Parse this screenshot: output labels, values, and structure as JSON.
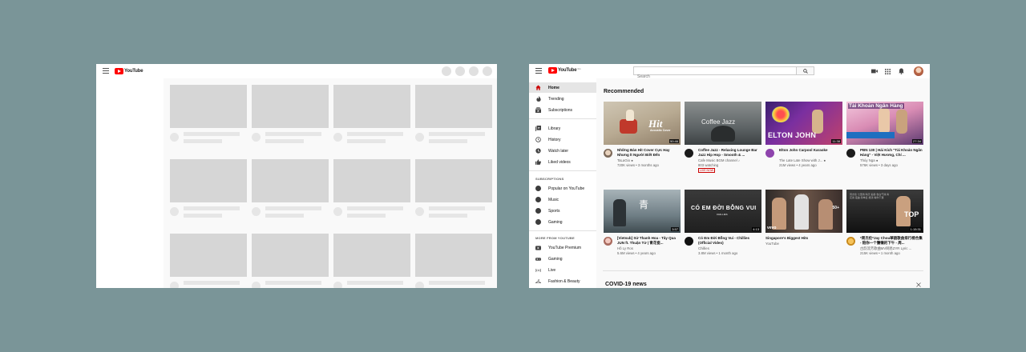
{
  "colors": {
    "background": "#7a9598",
    "brand_red": "#ff0000",
    "live_badge": "#cc0000"
  },
  "skeleton": {
    "logo_text": "YouTube"
  },
  "app": {
    "logo_text": "YouTube",
    "logo_region": "SG",
    "search": {
      "placeholder": "Search"
    },
    "header_icons": [
      "video-camera-icon",
      "apps-grid-icon",
      "bell-icon"
    ]
  },
  "sidebar": {
    "main": [
      {
        "label": "Home",
        "icon": "home-icon"
      },
      {
        "label": "Trending",
        "icon": "flame-icon"
      },
      {
        "label": "Subscriptions",
        "icon": "subscriptions-icon"
      }
    ],
    "library": [
      {
        "label": "Library",
        "icon": "library-icon"
      },
      {
        "label": "History",
        "icon": "history-icon"
      },
      {
        "label": "Watch later",
        "icon": "clock-icon"
      },
      {
        "label": "Liked videos",
        "icon": "thumb-up-icon"
      }
    ],
    "subscriptions_heading": "SUBSCRIPTIONS",
    "subscriptions": [
      {
        "label": "Popular on YouTube"
      },
      {
        "label": "Music"
      },
      {
        "label": "Sports"
      },
      {
        "label": "Gaming"
      }
    ],
    "more_heading": "MORE FROM YOUTUBE",
    "more": [
      {
        "label": "YouTube Premium",
        "icon": "youtube-icon"
      },
      {
        "label": "Gaming",
        "icon": "gamepad-icon"
      },
      {
        "label": "Live",
        "icon": "live-icon"
      },
      {
        "label": "Fashion & Beauty",
        "icon": "hanger-icon"
      }
    ]
  },
  "main": {
    "section_title": "Recommended",
    "videos": [
      {
        "title": "Những Bản Hit Cover Cực Hay Nhưng Ít Người Biết Đến",
        "channel": "TaLaGio",
        "verified": true,
        "stats": "720K views • 3 months ago",
        "duration": "50:46",
        "overlay": "Hit",
        "overlay2": "Acoustic Cover"
      },
      {
        "title": "Coffee Jazz - Relaxing Lounge Bar Jazz Hip Hop - Smooth & ...",
        "channel": "Cafe Music BGM channel",
        "verified": true,
        "stats": "803 watching",
        "badge": "LIVE NOW",
        "overlay": "Coffee Jazz"
      },
      {
        "title": "Elton John Carpool Karaoke",
        "channel": "The Late Late Show with J...",
        "verified": true,
        "stats": "21M views • 4 years ago",
        "duration": "11:38",
        "overlay": "ELTON JOHN"
      },
      {
        "title": "PBN 130 | Hải Kích \"Tài Khoản Ngân Hàng\" - Việt Hương, Chí ...",
        "channel": "Thúy Nga",
        "verified": true,
        "stats": "576K views • 3 days ago",
        "duration": "27:34",
        "overlay": "Tài Khoản Ngân Hàng"
      },
      {
        "title": "[Vietsub] Sử Thanh Hoa - Tây Qua JUN ft. Thuận Tử | 青花瓷...",
        "channel": "Hồ Ly Ros",
        "stats": "5.6M views • 4 years ago",
        "duration": "3:57"
      },
      {
        "title": "Có Em Đời Bỗng Vui - Chillies (Official Video)",
        "channel": "Chillies",
        "stats": "3.8M views • 1 month ago",
        "duration": "4:13",
        "overlay": "CÓ EM ĐỜI BỖNG VUI",
        "overlay2": "CHILLIES"
      },
      {
        "title": "Singapore's Biggest Hits",
        "channel": "YouTube",
        "stats": "",
        "overlay": "vevo",
        "overlay2": "50+"
      },
      {
        "title": "*周杰伦*Jay Chou華語歌曲排行榜合集 - 陪你一个慵懒的下午 - 周...",
        "channel": "古韵流芳歌曲MV网易ZYR Lyric ...",
        "stats": "215K views • 1 month ago",
        "duration": "1:15:31",
        "overlay": "TOP"
      }
    ],
    "covid_title": "COVID-19 news"
  }
}
